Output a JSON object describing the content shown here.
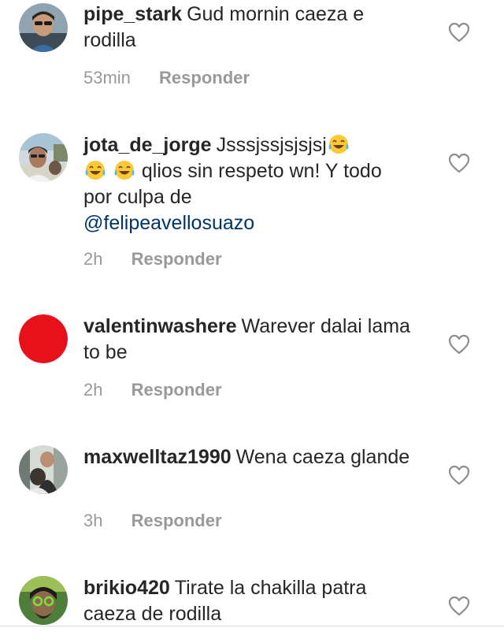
{
  "comments": [
    {
      "username": "pipe_stark",
      "text": "Gud mornin caeza e rodilla",
      "time": "53min",
      "reply_label": "Responder"
    },
    {
      "username": "jota_de_jorge",
      "text_a": "Jsssjssjsjsjsj",
      "text_b": "qlios sin respeto wn! Y todo por culpa de",
      "mention": "@felipeavellosuazo",
      "time": "2h",
      "reply_label": "Responder"
    },
    {
      "username": "valentinwashere",
      "text": "Warever dalai lama to be",
      "time": "2h",
      "reply_label": "Responder"
    },
    {
      "username": "maxwelltaz1990",
      "text": "Wena caeza glande",
      "time": "3h",
      "reply_label": "Responder"
    },
    {
      "username": "brikio420",
      "text": "Tirate la chakilla patra caeza de rodilla"
    }
  ],
  "colors": {
    "text": "#262626",
    "meta": "#999999",
    "mention": "#003569",
    "red_avatar": "#e8101a"
  }
}
